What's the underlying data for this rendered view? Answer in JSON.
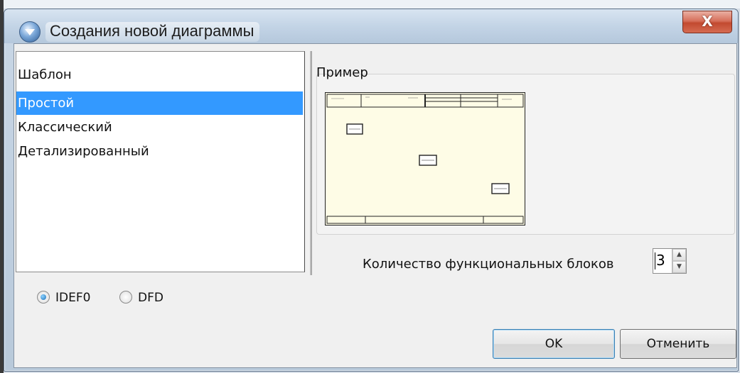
{
  "window": {
    "title": "Создания новой диаграммы",
    "close_label": "X"
  },
  "templates": {
    "header": "Шаблон",
    "items": [
      {
        "label": "Простой",
        "selected": true
      },
      {
        "label": "Классический",
        "selected": false
      },
      {
        "label": "Детализированный",
        "selected": false
      }
    ]
  },
  "example": {
    "label": "Пример"
  },
  "blocks": {
    "label": "Количество функциональных блоков",
    "value": "3"
  },
  "method": {
    "options": [
      {
        "label": "IDEF0",
        "checked": true
      },
      {
        "label": "DFD",
        "checked": false
      }
    ]
  },
  "buttons": {
    "ok": "OK",
    "cancel": "Отменить"
  },
  "colors": {
    "selection": "#3399ff",
    "preview_bg": "#fefce6",
    "close_button": "#c24a30"
  }
}
